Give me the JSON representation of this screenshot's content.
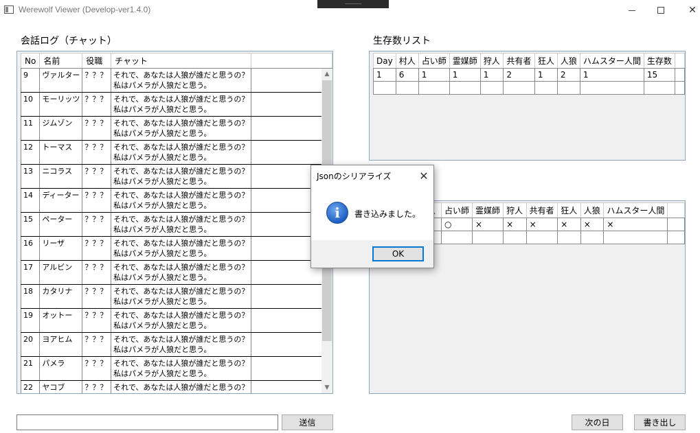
{
  "window": {
    "title": "Werewolf Viewer (Develop-ver1.4.0)"
  },
  "chat_log": {
    "label": "会話ログ（チャット）",
    "headers": [
      "No",
      "名前",
      "役職",
      "チャット"
    ],
    "rows": [
      {
        "no": "9",
        "name": "ヴァルター",
        "role": "？？？",
        "line1": "それで、あなたは人狼が誰だと思うの？",
        "line2": "私はパメラが人狼だと思う。"
      },
      {
        "no": "10",
        "name": "モーリッツ",
        "role": "？？？",
        "line1": "それで、あなたは人狼が誰だと思うの？",
        "line2": "私はパメラが人狼だと思う。"
      },
      {
        "no": "11",
        "name": "ジムゾン",
        "role": "？？？",
        "line1": "それで、あなたは人狼が誰だと思うの？",
        "line2": "私はパメラが人狼だと思う。"
      },
      {
        "no": "12",
        "name": "トーマス",
        "role": "？？？",
        "line1": "それで、あなたは人狼が誰だと思うの？",
        "line2": "私はパメラが人狼だと思う。"
      },
      {
        "no": "13",
        "name": "ニコラス",
        "role": "？？？",
        "line1": "それで、あなたは人狼が誰だと思うの？",
        "line2": "私はパメラが人狼だと思う。"
      },
      {
        "no": "14",
        "name": "ディーター",
        "role": "？？？",
        "line1": "それで、あなたは人狼が誰だと思うの？",
        "line2": "私はパメラが人狼だと思う。"
      },
      {
        "no": "15",
        "name": "ペーター",
        "role": "？？？",
        "line1": "それで、あなたは人狼が誰だと思うの？",
        "line2": "私はパメラが人狼だと思う。"
      },
      {
        "no": "16",
        "name": "リーザ",
        "role": "？？？",
        "line1": "それで、あなたは人狼が誰だと思うの？",
        "line2": "私はパメラが人狼だと思う。"
      },
      {
        "no": "17",
        "name": "アルビン",
        "role": "？？？",
        "line1": "それで、あなたは人狼が誰だと思うの？",
        "line2": "私はパメラが人狼だと思う。"
      },
      {
        "no": "18",
        "name": "カタリナ",
        "role": "？？？",
        "line1": "それで、あなたは人狼が誰だと思うの？",
        "line2": "私はパメラが人狼だと思う。"
      },
      {
        "no": "19",
        "name": "オットー",
        "role": "？？？",
        "line1": "それで、あなたは人狼が誰だと思うの？",
        "line2": "私はパメラが人狼だと思う。"
      },
      {
        "no": "20",
        "name": "ヨアヒム",
        "role": "？？？",
        "line1": "それで、あなたは人狼が誰だと思うの？",
        "line2": "私はパメラが人狼だと思う。"
      },
      {
        "no": "21",
        "name": "パメラ",
        "role": "？？？",
        "line1": "それで、あなたは人狼が誰だと思うの？",
        "line2": "私はパメラが人狼だと思う。"
      },
      {
        "no": "22",
        "name": "ヤコブ",
        "role": "？？？",
        "line1": "それで、あなたは人狼が誰だと思うの？",
        "line2": ""
      }
    ]
  },
  "survivors": {
    "label": "生存数リスト",
    "headers": [
      "Day",
      "村人",
      "占い師",
      "霊媒師",
      "狩人",
      "共有者",
      "狂人",
      "人狼",
      "ハムスター人間",
      "生存数"
    ],
    "rows": [
      [
        "1",
        "6",
        "1",
        "1",
        "1",
        "2",
        "1",
        "2",
        "1",
        "15"
      ],
      [
        "",
        "",
        "",
        "",
        "",
        "",
        "",
        "",
        "",
        ""
      ]
    ]
  },
  "roles_grid": {
    "headers": [
      "人",
      "占い師",
      "霊媒師",
      "狩人",
      "共有者",
      "狂人",
      "人狼",
      "ハムスター人間"
    ],
    "rows": [
      [
        "",
        "○",
        "×",
        "×",
        "×",
        "×",
        "×",
        "×"
      ],
      [
        "",
        "",
        "",
        "",
        "",
        "",
        "",
        ""
      ]
    ]
  },
  "controls": {
    "chat_input_value": "",
    "send_label": "送信",
    "next_day_label": "次の日",
    "write_label": "書き出し"
  },
  "dialog": {
    "title": "Jsonのシリアライズ",
    "message": "書き込みました。",
    "ok_label": "OK",
    "close_glyph": "✕",
    "icon_glyph": "i"
  }
}
